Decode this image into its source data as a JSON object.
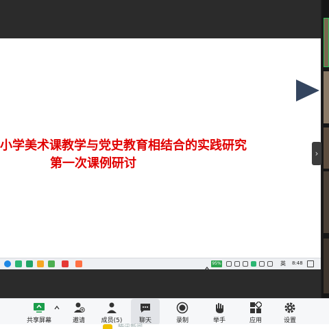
{
  "slide": {
    "title_line1": "小学美术课教学与党史教育相结合的实践研究",
    "title_line2": "第一次课例研讨",
    "title_color": "#e00000"
  },
  "taskbar": {
    "battery": "95%",
    "ime": "英",
    "time": "8:48"
  },
  "toolbar": {
    "share": "共享屏幕",
    "invite": "邀请",
    "members": "成员(5)",
    "chat": "聊天",
    "record": "录制",
    "raise_hand": "举手",
    "apps": "应用",
    "settings": "设置"
  },
  "bottom": {
    "text": "腾讯新闻"
  },
  "colors": {
    "accent_green": "#2ec35a",
    "nav_triangle": "#34455f"
  }
}
